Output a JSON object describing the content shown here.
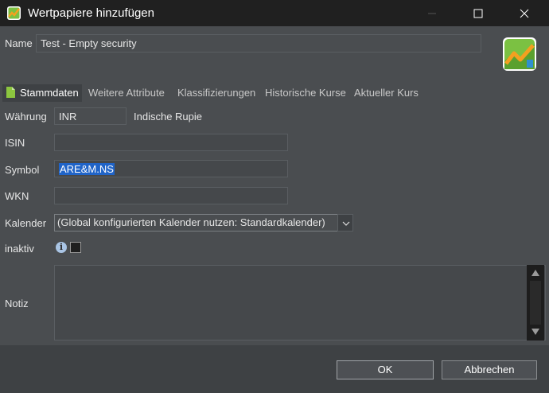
{
  "window": {
    "title": "Wertpapiere hinzufügen"
  },
  "header": {
    "name_label": "Name",
    "name_value": "Test - Empty security"
  },
  "tabs": [
    {
      "label": "Stammdaten",
      "active": true
    },
    {
      "label": "Weitere Attribute"
    },
    {
      "label": "Klassifizierungen"
    },
    {
      "label": "Historische Kurse"
    },
    {
      "label": "Aktueller Kurs"
    }
  ],
  "form": {
    "currency_label": "Währung",
    "currency_code": "INR",
    "currency_name": "Indische Rupie",
    "isin_label": "ISIN",
    "isin_value": "",
    "symbol_label": "Symbol",
    "symbol_value": "ARE&M.NS",
    "wkn_label": "WKN",
    "wkn_value": "",
    "calendar_label": "Kalender",
    "calendar_value": "(Global konfigurierten Kalender nutzen: Standardkalender)",
    "inactive_label": "inaktiv",
    "inactive_checked": false,
    "note_label": "Notiz",
    "note_value": ""
  },
  "buttons": {
    "ok": "OK",
    "cancel": "Abbrechen"
  },
  "icons": {
    "app": "portfolio-performance-logo",
    "info": "info-icon",
    "doc": "document-icon"
  },
  "colors": {
    "selection": "#2064c8",
    "logo_green": "#7bc142",
    "logo_orange": "#f4a020"
  }
}
